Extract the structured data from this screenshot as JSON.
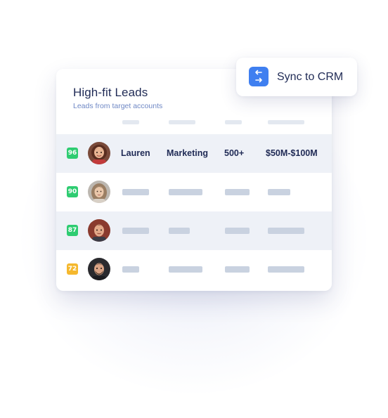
{
  "card": {
    "title": "High-fit Leads",
    "subtitle": "Leads from target accounts"
  },
  "sync_button": {
    "label": "Sync to CRM",
    "icon": "sync-arrows-icon",
    "color": "#3f7ff0"
  },
  "score_colors": {
    "high": "#2ecc71",
    "medium": "#f5b82e"
  },
  "leads": [
    {
      "score": "96",
      "score_level": "high",
      "name": "Lauren",
      "department": "Marketing",
      "employees": "500+",
      "revenue": "$50M-$100M",
      "details_visible": true
    },
    {
      "score": "90",
      "score_level": "high",
      "details_visible": false
    },
    {
      "score": "87",
      "score_level": "high",
      "details_visible": false
    },
    {
      "score": "72",
      "score_level": "medium",
      "details_visible": false
    }
  ]
}
